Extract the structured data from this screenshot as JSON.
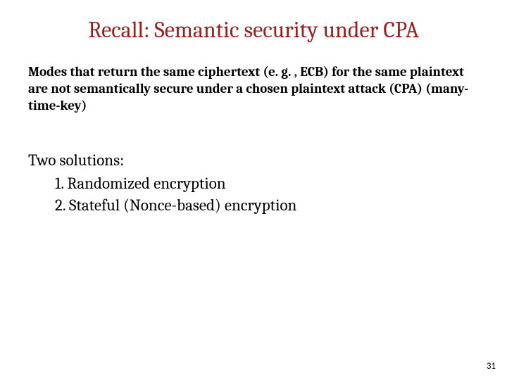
{
  "slide": {
    "title": "Recall: Semantic security under CPA",
    "paragraph": "Modes that return the same ciphertext (e. g. , ECB) for the same plaintext are not semantically secure under a chosen plaintext attack (CPA) (many-time-key)",
    "solutions_label": "Two solutions:",
    "solutions": [
      "1.  Randomized encryption",
      "2.  Stateful (Nonce-based) encryption"
    ],
    "page_number": "31"
  }
}
